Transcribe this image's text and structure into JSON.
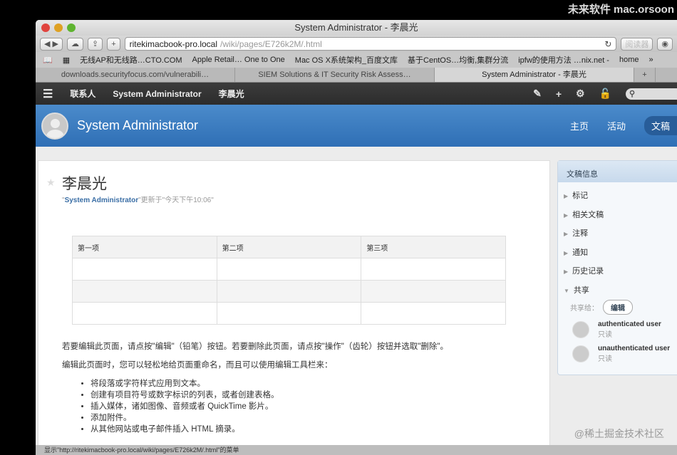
{
  "browser": {
    "title": "System Administrator - 李晨光",
    "url_host": "ritekimacbook-pro.local",
    "url_path": "/wiki/pages/E726k2M/.html",
    "reader": "阅读器",
    "bookmarks": [
      "无线AP和无线路…CTO.COM",
      "Apple Retail… One to One",
      "Mac OS X系统架构_百度文库",
      "基于CentOS…均衡,集群分流",
      "ipfw的使用方法 …nix.net -",
      "home"
    ],
    "tabs": [
      "downloads.securityfocus.com/vulnerabili…",
      "SIEM Solutions & IT Security Risk Assess…",
      "System Administrator - 李晨光"
    ],
    "status": "显示\"http://ritekimacbook-pro.local/wiki/pages/E726k2M/.html\"的菜单"
  },
  "nav": {
    "items": [
      "联系人",
      "System Administrator",
      "李晨光"
    ]
  },
  "header": {
    "title": "System Administrator",
    "tabs": [
      "主页",
      "活动",
      "文稿"
    ]
  },
  "page": {
    "title": "李晨光",
    "author": "System Administrator",
    "updated": "更新于\"今天下午10:06\"",
    "table": {
      "headers": [
        "第一项",
        "第二项",
        "第三项"
      ]
    },
    "para1": "若要编辑此页面，请点按\"编辑\"（铅笔）按钮。若要删除此页面，请点按\"操作\"（齿轮）按钮并选取\"删除\"。",
    "para2": "编辑此页面时，您可以轻松地给页面重命名，而且可以使用编辑工具栏来：",
    "bullets": [
      "将段落或字符样式应用到文本。",
      "创建有项目符号或数字标识的列表，或者创建表格。",
      "插入媒体，诸如图像、音频或者 QuickTime 影片。",
      "添加附件。",
      "从其他网站或电子邮件插入 HTML 摘录。"
    ]
  },
  "sidebar": {
    "title": "文稿信息",
    "items": [
      "标记",
      "相关文稿",
      "注释",
      "通知",
      "历史记录",
      "共享"
    ],
    "share_to": "共享给：",
    "edit": "编辑",
    "users": [
      {
        "name": "authenticated user",
        "role": "只读"
      },
      {
        "name": "unauthenticated user",
        "role": "只读"
      }
    ]
  },
  "watermarks": {
    "top": "未来软件 mac.orsoon",
    "bottom": "@稀土掘金技术社区"
  }
}
